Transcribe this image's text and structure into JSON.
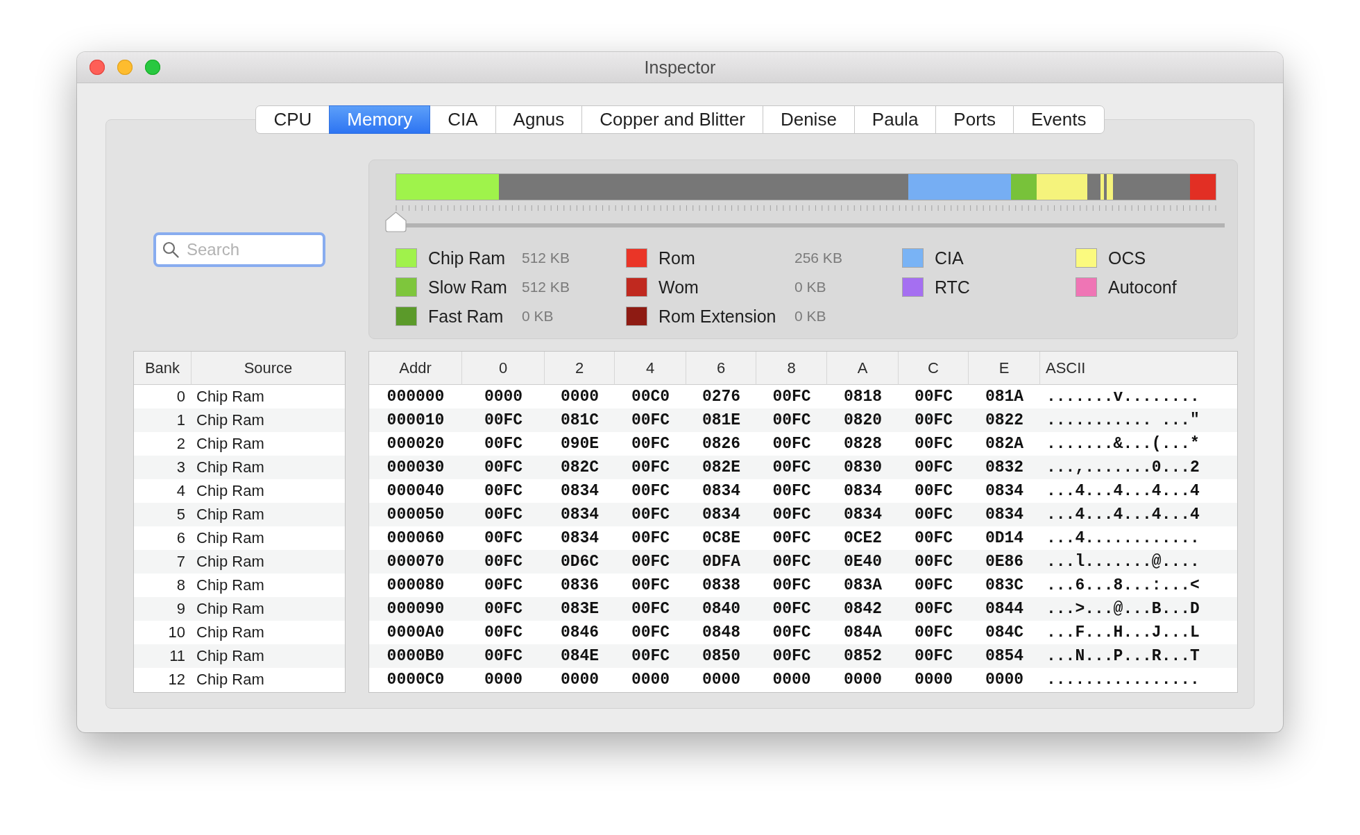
{
  "window": {
    "title": "Inspector"
  },
  "tabs": [
    {
      "label": "CPU",
      "selected": false
    },
    {
      "label": "Memory",
      "selected": true
    },
    {
      "label": "CIA",
      "selected": false
    },
    {
      "label": "Agnus",
      "selected": false
    },
    {
      "label": "Copper and Blitter",
      "selected": false
    },
    {
      "label": "Denise",
      "selected": false
    },
    {
      "label": "Paula",
      "selected": false
    },
    {
      "label": "Ports",
      "selected": false
    },
    {
      "label": "Events",
      "selected": false
    }
  ],
  "search": {
    "placeholder": "Search"
  },
  "memory_map": {
    "segments": [
      {
        "color": "#9ff34b"
      },
      {
        "color": "#777777"
      },
      {
        "color": "#76aef3"
      },
      {
        "color": "#78c23a"
      },
      {
        "color": "#f5f37c"
      },
      {
        "color": "#777777"
      },
      {
        "color": "#f5f37c"
      },
      {
        "color": "#777777"
      },
      {
        "color": "#f5f37c"
      },
      {
        "color": "#777777"
      },
      {
        "color": "#e22f24"
      }
    ],
    "slider": {
      "level": 0
    }
  },
  "legend": [
    {
      "items": [
        {
          "label": "Chip Ram",
          "size": "512 KB",
          "color": "#a0f24b"
        },
        {
          "label": "Slow Ram",
          "size": "512 KB",
          "color": "#7ec63c"
        },
        {
          "label": "Fast Ram",
          "size": "0 KB",
          "color": "#5b9a2a"
        }
      ]
    },
    {
      "items": [
        {
          "label": "Rom",
          "size": "256 KB",
          "color": "#ea3527"
        },
        {
          "label": "Wom",
          "size": "0 KB",
          "color": "#c0291f"
        },
        {
          "label": "Rom Extension",
          "size": "0 KB",
          "color": "#8e1b13"
        }
      ]
    },
    {
      "items": [
        {
          "label": "CIA",
          "color": "#79b3f5"
        },
        {
          "label": "RTC",
          "color": "#a56ff1"
        }
      ]
    },
    {
      "items": [
        {
          "label": "OCS",
          "color": "#fbfa7f"
        },
        {
          "label": "Autoconf",
          "color": "#ef75b5"
        }
      ]
    }
  ],
  "bank_table": {
    "columns": [
      "Bank",
      "Source"
    ],
    "rows": [
      {
        "bank": "0",
        "source": "Chip Ram"
      },
      {
        "bank": "1",
        "source": "Chip Ram"
      },
      {
        "bank": "2",
        "source": "Chip Ram"
      },
      {
        "bank": "3",
        "source": "Chip Ram"
      },
      {
        "bank": "4",
        "source": "Chip Ram"
      },
      {
        "bank": "5",
        "source": "Chip Ram"
      },
      {
        "bank": "6",
        "source": "Chip Ram"
      },
      {
        "bank": "7",
        "source": "Chip Ram"
      },
      {
        "bank": "8",
        "source": "Chip Ram"
      },
      {
        "bank": "9",
        "source": "Chip Ram"
      },
      {
        "bank": "10",
        "source": "Chip Ram"
      },
      {
        "bank": "11",
        "source": "Chip Ram"
      },
      {
        "bank": "12",
        "source": "Chip Ram"
      }
    ]
  },
  "memory_table": {
    "columns": [
      "Addr",
      "0",
      "2",
      "4",
      "6",
      "8",
      "A",
      "C",
      "E",
      "ASCII"
    ],
    "rows": [
      {
        "addr": "000000",
        "words": [
          "0000",
          "0000",
          "00C0",
          "0276",
          "00FC",
          "0818",
          "00FC",
          "081A"
        ],
        "ascii": ".......v........"
      },
      {
        "addr": "000010",
        "words": [
          "00FC",
          "081C",
          "00FC",
          "081E",
          "00FC",
          "0820",
          "00FC",
          "0822"
        ],
        "ascii": "........... ...\""
      },
      {
        "addr": "000020",
        "words": [
          "00FC",
          "090E",
          "00FC",
          "0826",
          "00FC",
          "0828",
          "00FC",
          "082A"
        ],
        "ascii": ".......&...(...*"
      },
      {
        "addr": "000030",
        "words": [
          "00FC",
          "082C",
          "00FC",
          "082E",
          "00FC",
          "0830",
          "00FC",
          "0832"
        ],
        "ascii": "...,.......0...2"
      },
      {
        "addr": "000040",
        "words": [
          "00FC",
          "0834",
          "00FC",
          "0834",
          "00FC",
          "0834",
          "00FC",
          "0834"
        ],
        "ascii": "...4...4...4...4"
      },
      {
        "addr": "000050",
        "words": [
          "00FC",
          "0834",
          "00FC",
          "0834",
          "00FC",
          "0834",
          "00FC",
          "0834"
        ],
        "ascii": "...4...4...4...4"
      },
      {
        "addr": "000060",
        "words": [
          "00FC",
          "0834",
          "00FC",
          "0C8E",
          "00FC",
          "0CE2",
          "00FC",
          "0D14"
        ],
        "ascii": "...4............"
      },
      {
        "addr": "000070",
        "words": [
          "00FC",
          "0D6C",
          "00FC",
          "0DFA",
          "00FC",
          "0E40",
          "00FC",
          "0E86"
        ],
        "ascii": "...l.......@...."
      },
      {
        "addr": "000080",
        "words": [
          "00FC",
          "0836",
          "00FC",
          "0838",
          "00FC",
          "083A",
          "00FC",
          "083C"
        ],
        "ascii": "...6...8...:...<"
      },
      {
        "addr": "000090",
        "words": [
          "00FC",
          "083E",
          "00FC",
          "0840",
          "00FC",
          "0842",
          "00FC",
          "0844"
        ],
        "ascii": "...>...@...B...D"
      },
      {
        "addr": "0000A0",
        "words": [
          "00FC",
          "0846",
          "00FC",
          "0848",
          "00FC",
          "084A",
          "00FC",
          "084C"
        ],
        "ascii": "...F...H...J...L"
      },
      {
        "addr": "0000B0",
        "words": [
          "00FC",
          "084E",
          "00FC",
          "0850",
          "00FC",
          "0852",
          "00FC",
          "0854"
        ],
        "ascii": "...N...P...R...T"
      },
      {
        "addr": "0000C0",
        "words": [
          "0000",
          "0000",
          "0000",
          "0000",
          "0000",
          "0000",
          "0000",
          "0000"
        ],
        "ascii": "................"
      }
    ]
  }
}
